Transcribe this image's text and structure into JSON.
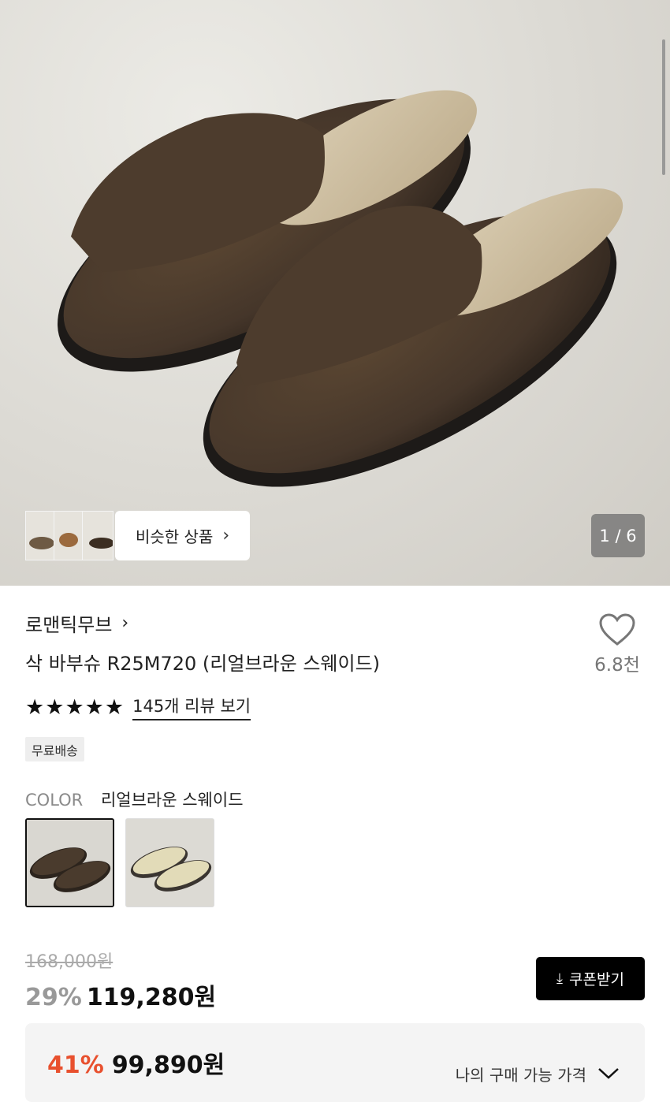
{
  "hero": {
    "similar_label": "비슷한 상품",
    "image_counter": "1 / 6"
  },
  "product": {
    "brand": "로맨틱무브",
    "title": "삭 바부슈 R25M720 (리얼브라운 스웨이드)",
    "like_count": "6.8천",
    "rating_stars": 5,
    "review_link": "145개 리뷰 보기",
    "badge": "무료배송"
  },
  "options": {
    "color_label": "COLOR",
    "color_value": "리얼브라운 스웨이드",
    "swatches": [
      "리얼브라운 스웨이드",
      "베이지"
    ]
  },
  "price": {
    "original": "168,000원",
    "discount_pct": "29%",
    "sale": "119,280원",
    "coupon_button": "쿠폰받기"
  },
  "my_price": {
    "discount_pct": "41%",
    "price": "99,890원",
    "label": "나의 구매 가능 가격"
  },
  "colors": {
    "accent_red": "#e8502e",
    "black": "#000000"
  }
}
